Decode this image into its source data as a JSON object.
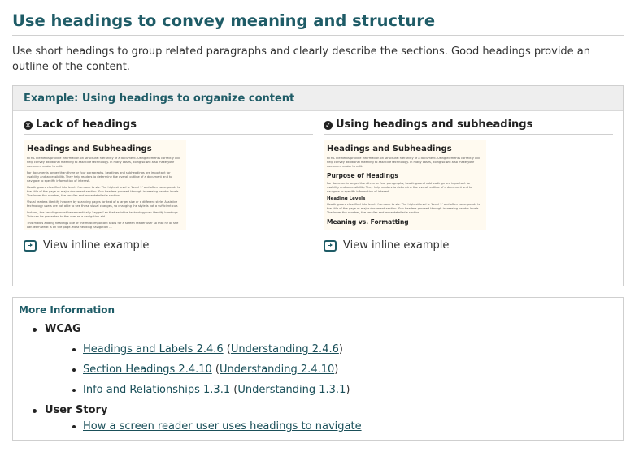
{
  "title": "Use headings to convey meaning and structure",
  "intro": "Use short headings to group related paragraphs and clearly describe the sections. Good headings provide an outline of the content.",
  "example": {
    "header": "Example: Using headings to organize content",
    "left": {
      "heading": "Lack of headings",
      "status_icon": "x-circle-icon",
      "thumb": {
        "h1": "Headings and Subheadings",
        "paragraphs": [
          "HTML elements provide information on structural hierarchy of a document. Using elements correctly will help convey additional meaning to assistive technology. In many cases, doing so will also make your document easier to edit.",
          "For documents longer than three or four paragraphs, headings and subheadings are important for usability and accessibility. They help readers to determine the overall outline of a document and to navigate to specific information of interest.",
          "Headings are classified into levels from one to six. The highest level is 'Level 1' and often corresponds to the title of the page or major document section. Sub-headers proceed through increasing header levels. The lower the number, the smaller and more detailed a section.",
          "Visual readers identify headers by scanning pages for text of a larger size or a different style. Assistive technology users are not able to see these visual changes, so changing the style is not a sufficient cue.",
          "Instead, the headings must be semantically 'tagged' so that assistive technology can identify headings. This can be presented to the user as a navigation aid.",
          "This makes adding headings one of the most important tasks for a screen reader user so that he or she can learn what is on the page. Most heading navigation ..."
        ]
      },
      "link": "View inline example"
    },
    "right": {
      "heading": "Using headings and subheadings",
      "status_icon": "check-circle-icon",
      "thumb": {
        "h1": "Headings and Subheadings",
        "p1": "HTML elements provide information on structural hierarchy of a document. Using elements correctly will help convey additional meaning to assistive technology. In many cases, doing so will also make your document easier to edit.",
        "h2": "Purpose of Headings",
        "p2": "For documents longer than three or four paragraphs, headings and subheadings are important for usability and accessibility. They help readers to determine the overall outline of a document and to navigate to specific information of interest.",
        "h3": "Heading Levels",
        "p3": "Headings are classified into levels from one to six. The highest level is 'Level 1' and often corresponds to the title of the page or major document section. Sub-headers proceed through increasing header levels. The lower the number, the smaller and more detailed a section.",
        "h2b": "Meaning vs. Formatting"
      },
      "link": "View inline example"
    }
  },
  "more": {
    "title": "More Information",
    "wcag_label": "WCAG",
    "wcag": [
      {
        "main": "Headings and Labels 2.4.6",
        "ref": "Understanding 2.4.6"
      },
      {
        "main": "Section Headings 2.4.10",
        "ref": "Understanding 2.4.10"
      },
      {
        "main": "Info and Relationships 1.3.1",
        "ref": "Understanding 1.3.1"
      }
    ],
    "story_label": "User Story",
    "story_link": "How a screen reader user uses headings to navigate"
  },
  "colors": {
    "accent": "#1f5c67",
    "thumb_bg": "#fffaf0",
    "header_bg": "#eeeeee"
  }
}
